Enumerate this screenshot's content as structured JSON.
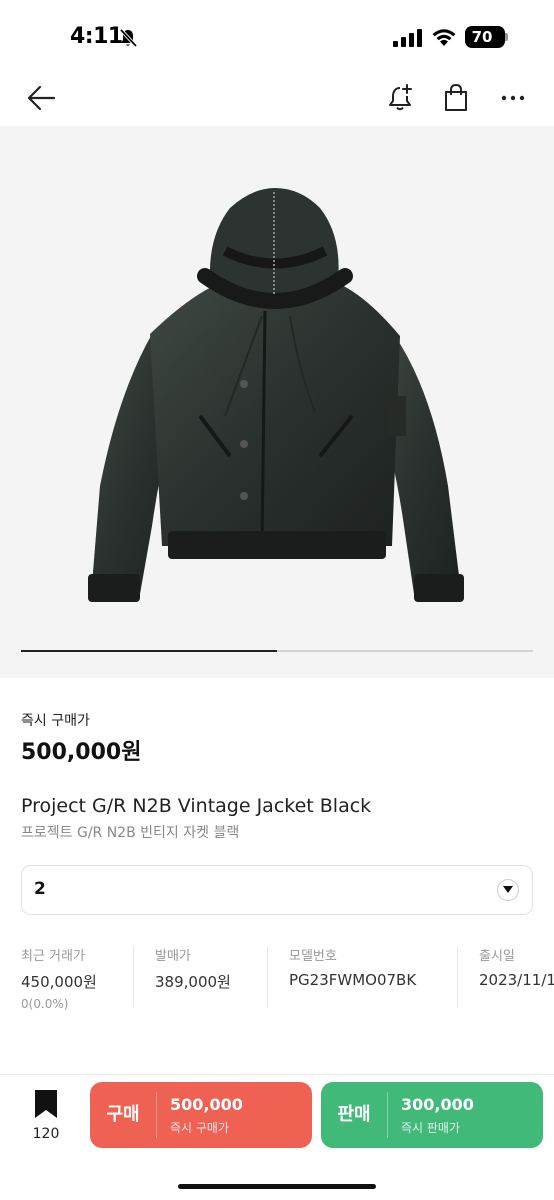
{
  "status_bar": {
    "time": "4:11",
    "battery": "70"
  },
  "product": {
    "price_label": "즉시 구매가",
    "price": "500,000원",
    "title_en": "Project G/R N2B Vintage Jacket Black",
    "title_ko": "프로젝트 G/R N2B 빈티지 자켓 블랙",
    "image_progress": 0.5
  },
  "size_select": {
    "value": "2"
  },
  "info": {
    "recent_label": "최근 거래가",
    "recent_value": "450,000원",
    "recent_change": "0(0.0%)",
    "release_price_label": "발매가",
    "release_price_value": "389,000원",
    "model_label": "모델번호",
    "model_value": "PG23FWMO07BK",
    "release_date_label": "출시일",
    "release_date_value": "2023/11/1"
  },
  "bottom_bar": {
    "bookmark_count": "120",
    "buy_label": "구매",
    "buy_price": "500,000",
    "buy_sub": "즉시 구매가",
    "sell_label": "판매",
    "sell_price": "300,000",
    "sell_sub": "즉시 판매가"
  },
  "colors": {
    "buy": "#ef6253",
    "sell": "#41b979",
    "image_bg": "#f4f4f4"
  }
}
